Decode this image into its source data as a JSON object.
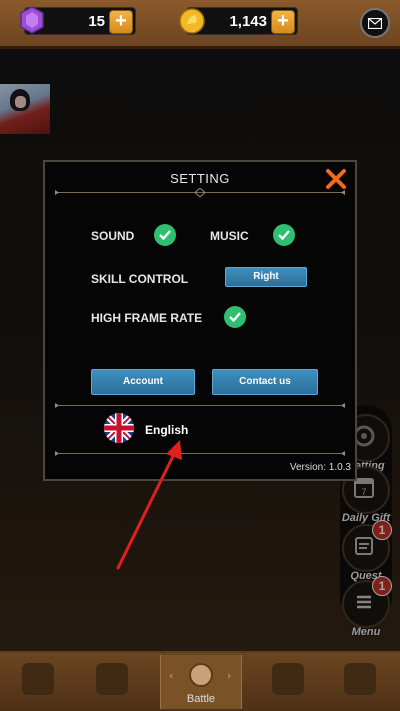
{
  "topbar": {
    "gems": "15",
    "gold": "1,143",
    "plus_symbol": "+",
    "gem_icon": "gem-icon",
    "coin_icon": "coin-icon",
    "mail_icon": "mail-icon"
  },
  "side_menu": [
    {
      "label": "Setting",
      "icon": "gear-icon",
      "badge": ""
    },
    {
      "label": "Daily Gift",
      "icon": "calendar-icon",
      "badge": ""
    },
    {
      "label": "Quest",
      "icon": "scroll-icon",
      "badge": "1"
    },
    {
      "label": "Menu",
      "icon": "menu-icon",
      "badge": "1"
    }
  ],
  "bottom_nav": {
    "battle_label": "Battle"
  },
  "dialog": {
    "title": "SETTING",
    "sound_label": "SOUND",
    "music_label": "MUSIC",
    "skill_control_label": "SKILL CONTROL",
    "skill_control_value": "Right",
    "high_frame_rate_label": "HIGH FRAME RATE",
    "account_button": "Account",
    "contact_button": "Contact us",
    "language": "English",
    "version": "Version: 1.0.3"
  },
  "colors": {
    "accent_blue": "#3e8fbf",
    "check_green": "#2fbf71",
    "close_orange": "#f26a1b",
    "annotation_red": "#e0201b"
  }
}
